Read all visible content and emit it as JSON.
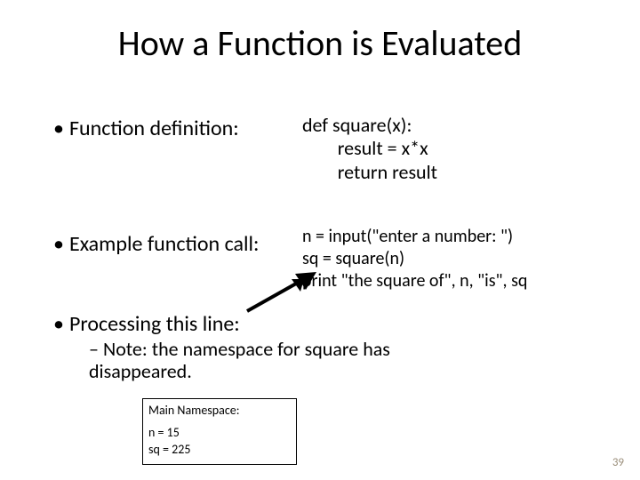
{
  "title": "How a Function is Evaluated",
  "bullets": {
    "b1": "Function definition:",
    "b2": "Example function call:",
    "b3": "Processing this line:"
  },
  "code": {
    "def": "def square(x):\n        result = x*x\n        return result",
    "call": "n = input(\"enter a number: \")\nsq = square(n)\nprint \"the square of\", n, \"is\", sq"
  },
  "subnote": "Note: the namespace for square has disappeared.",
  "namespace": {
    "header": "Main Namespace:",
    "lines": [
      "n = 15",
      "sq = 225"
    ]
  },
  "pagenum": "39",
  "icons": {
    "arrow": "arrow-right-icon"
  }
}
